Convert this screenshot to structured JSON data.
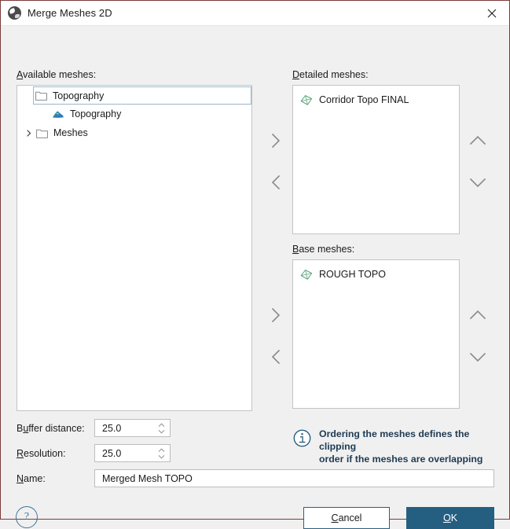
{
  "window": {
    "title": "Merge Meshes 2D",
    "icon": "merge-meshes-app-icon",
    "close_label": "close-icon"
  },
  "available": {
    "label_prefix": "A",
    "label_rest": "vailable meshes:",
    "tree": [
      {
        "type": "folder",
        "label": "Topography",
        "expanded": true,
        "selected": true,
        "icon": "folder-icon",
        "twisty": "chevron-down-icon"
      },
      {
        "type": "terrain",
        "label": "Topography",
        "icon": "terrain-icon"
      },
      {
        "type": "folder",
        "label": "Meshes",
        "expanded": false,
        "selected": false,
        "icon": "folder-icon",
        "twisty": "chevron-right-icon"
      }
    ]
  },
  "detailed": {
    "label_prefix": "D",
    "label_rest": "etailed meshes:",
    "items": [
      {
        "label": "Corridor Topo FINAL",
        "icon": "mesh-icon"
      }
    ]
  },
  "base": {
    "label_prefix": "B",
    "label_rest": "ase meshes:",
    "items": [
      {
        "label": "ROUGH TOPO",
        "icon": "mesh-icon"
      }
    ]
  },
  "transfer": {
    "add_detailed": "chevron-right-icon",
    "remove_detailed": "chevron-left-icon",
    "add_base": "chevron-right-icon",
    "remove_base": "chevron-left-icon",
    "move_up_detailed": "chevron-up-icon",
    "move_down_detailed": "chevron-down-icon",
    "move_up_base": "chevron-up-icon",
    "move_down_base": "chevron-down-icon"
  },
  "fields": {
    "buffer_distance": {
      "label_prefix": "B",
      "label_mid": "u",
      "label_rest": "ffer distance:",
      "value": "25.0"
    },
    "resolution": {
      "label_prefix": "R",
      "label_rest": "esolution:",
      "value": "25.0"
    },
    "name": {
      "label_prefix": "N",
      "label_rest": "ame:",
      "value": "Merged Mesh TOPO"
    }
  },
  "info": {
    "icon": "info-icon",
    "line1": "Ordering the meshes defines the clipping",
    "line2": "order if the meshes are overlapping"
  },
  "footer": {
    "help": "?",
    "cancel_prefix": "",
    "cancel_accel": "C",
    "cancel_rest": "ancel",
    "ok_accel": "O",
    "ok_rest": "K"
  },
  "colors": {
    "accent": "#245f82",
    "info_text": "#1f3a52",
    "mesh_icon": "#5aa87a",
    "dialog_bg": "#f0f0f0",
    "border": "#7a3b3b"
  }
}
